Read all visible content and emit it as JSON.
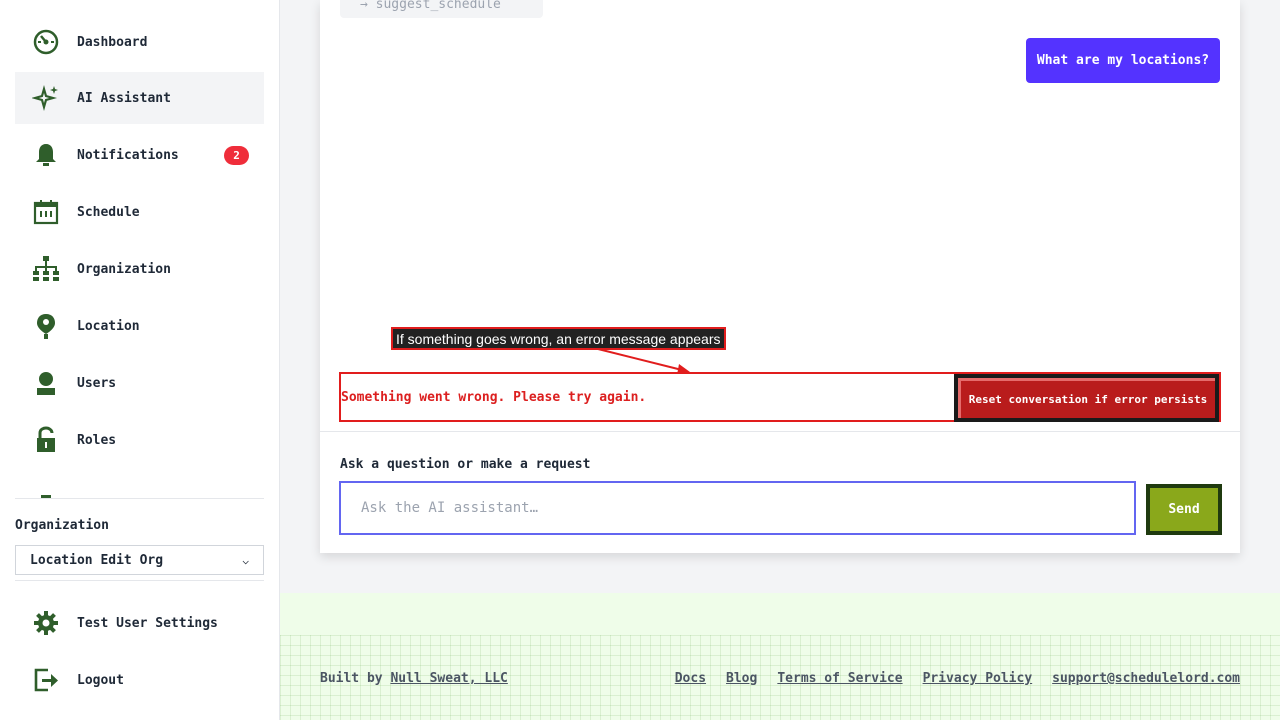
{
  "sidebar": {
    "items": [
      {
        "label": "Dashboard",
        "icon": "dashboard-icon"
      },
      {
        "label": "AI Assistant",
        "icon": "sparkle-icon"
      },
      {
        "label": "Notifications",
        "icon": "bell-icon",
        "badge": "2"
      },
      {
        "label": "Schedule",
        "icon": "calendar-icon"
      },
      {
        "label": "Organization",
        "icon": "org-chart-icon"
      },
      {
        "label": "Location",
        "icon": "map-pin-icon"
      },
      {
        "label": "Users",
        "icon": "user-icon"
      },
      {
        "label": "Roles",
        "icon": "unlock-icon"
      }
    ],
    "org_label": "Organization",
    "org_selected": "Location Edit Org",
    "settings_label": "Test User Settings",
    "logout_label": "Logout"
  },
  "chat": {
    "tool_chip": "→ suggest_schedule",
    "user_message": "What are my locations?",
    "annotation": "If something goes wrong, an error message appears",
    "error_text": "Something went wrong. Please try again.",
    "reset_label": "Reset conversation if error persists",
    "input_label": "Ask a question or make a request",
    "input_placeholder": "Ask the AI assistant…",
    "send_label": "Send"
  },
  "footer": {
    "built_prefix": "Built by",
    "built_link": "Null Sweat, LLC",
    "links": [
      "Docs",
      "Blog",
      "Terms of Service",
      "Privacy Policy",
      "support@schedulelord.com"
    ]
  },
  "colors": {
    "icon_green": "#2f5e2b",
    "accent": "#5433ff",
    "error": "#dc1f1f",
    "send": "#8aa81b",
    "badge": "#ef2d3a"
  }
}
